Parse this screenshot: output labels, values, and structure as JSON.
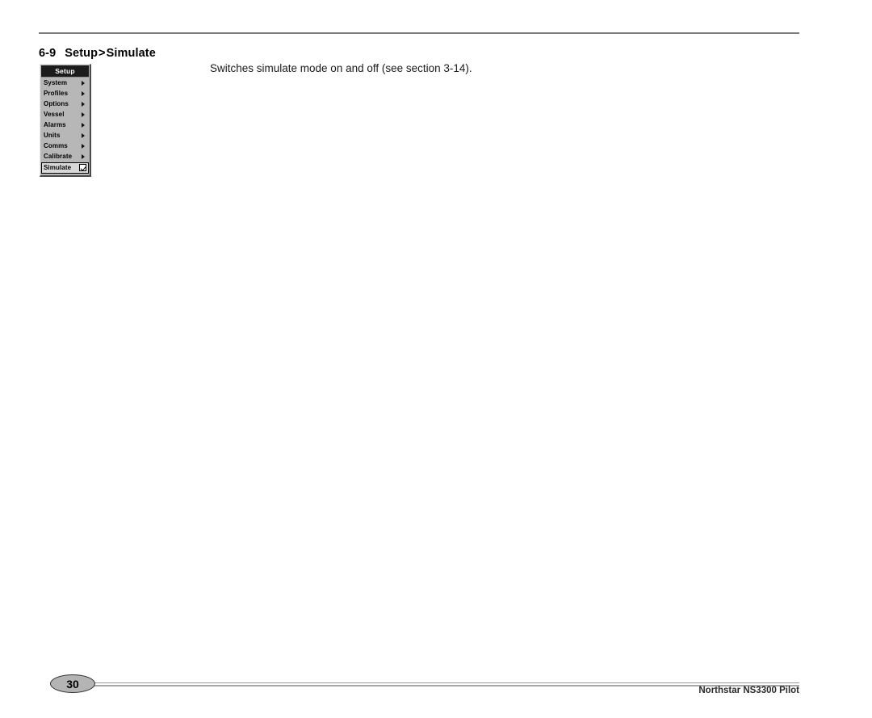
{
  "header": {
    "section_number": "6-9",
    "title_parts": {
      "first": "Setup",
      "separator": ">",
      "second": "Simulate"
    },
    "title_full": "6-9  Setup > Simulate"
  },
  "device_menu": {
    "title": "Setup",
    "items": [
      {
        "label": "System",
        "indicator": "submenu-arrow-icon",
        "selected": false
      },
      {
        "label": "Profiles",
        "indicator": "submenu-arrow-icon",
        "selected": false
      },
      {
        "label": "Options",
        "indicator": "submenu-arrow-icon",
        "selected": false
      },
      {
        "label": "Vessel",
        "indicator": "submenu-arrow-icon",
        "selected": false
      },
      {
        "label": "Alarms",
        "indicator": "submenu-arrow-icon",
        "selected": false
      },
      {
        "label": "Units",
        "indicator": "submenu-arrow-icon",
        "selected": false
      },
      {
        "label": "Comms",
        "indicator": "submenu-arrow-icon",
        "selected": false
      },
      {
        "label": "Calibrate",
        "indicator": "submenu-arrow-icon",
        "selected": false
      },
      {
        "label": "Simulate",
        "indicator": "checkbox-checked-icon",
        "selected": true
      }
    ]
  },
  "body": {
    "paragraph": "Switches simulate mode on and off (see section 3-14)."
  },
  "footer": {
    "page_number": "30",
    "product": "Northstar NS3300 Pilot"
  },
  "colors": {
    "rule": "#7d7d7d",
    "menu_background": "#b7b7b7",
    "menu_title_background": "#1c1c1c",
    "menu_title_text": "#ffffff",
    "selected_row_background": "#d8d8d8",
    "page_badge_fill": "#b4b4b4",
    "text": "#000000"
  }
}
